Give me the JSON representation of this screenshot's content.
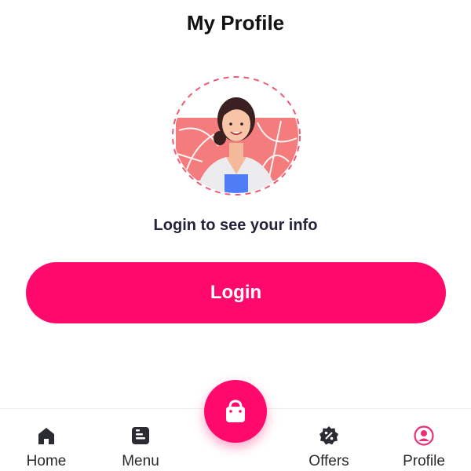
{
  "header": {
    "title": "My Profile"
  },
  "profile": {
    "avatar_icon": "user-avatar-illustration",
    "prompt": "Login to see your info"
  },
  "actions": {
    "login_label": "Login"
  },
  "colors": {
    "accent": "#ff0a6c",
    "text_dark": "#1d1d2b",
    "icon_dark": "#2b2b33",
    "avatar_bg": "#f47c7c"
  },
  "nav": {
    "center_icon": "shopping-bag-icon",
    "items": [
      {
        "label": "Home",
        "icon": "home-icon"
      },
      {
        "label": "Menu",
        "icon": "menu-doc-icon"
      },
      {
        "label": "Offers",
        "icon": "offers-badge-icon"
      },
      {
        "label": "Profile",
        "icon": "profile-icon",
        "active": true
      }
    ]
  }
}
